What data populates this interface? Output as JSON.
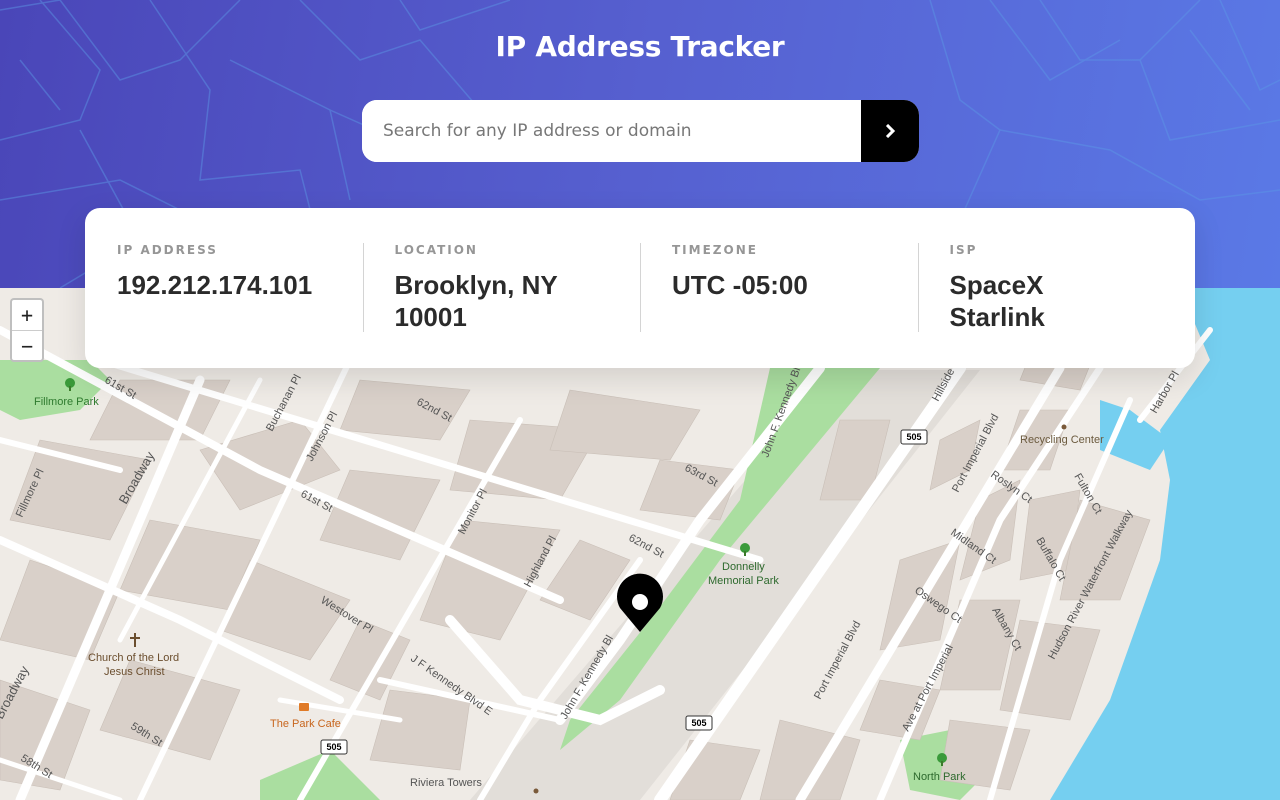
{
  "header": {
    "title": "IP Address Tracker",
    "search_placeholder": "Search for any IP address or domain",
    "search_value": ""
  },
  "info": [
    {
      "label": "IP ADDRESS",
      "value": "192.212.174.101"
    },
    {
      "label": "LOCATION",
      "value": "Brooklyn, NY 10001"
    },
    {
      "label": "TIMEZONE",
      "value": "UTC -05:00"
    },
    {
      "label": "ISP",
      "value": "SpaceX Starlink"
    }
  ],
  "map": {
    "zoom_in": "+",
    "zoom_out": "−",
    "labels": {
      "fillmore_park": "Fillmore Park",
      "st_61": "61st St",
      "buchanan": "Buchanan Pl",
      "johnson": "Johnson Pl",
      "st_62": "62nd St",
      "jfk_blvd": "John F. Kennedy Blvd",
      "hillside": "Hillside",
      "harbor": "Harbor Pl",
      "port_imperial": "Port Imperial Blvd",
      "recycling": "Recycling Center",
      "fillmore_pl": "Fillmore Pl",
      "broadway": "Broadway",
      "st_61b": "61st St",
      "monitor": "Monitor Pl",
      "st_63": "63rd St",
      "roslyn": "Roslyn Ct",
      "fulton": "Fulton Ct",
      "hudson": "Hudson River Waterfront Walkway",
      "highland": "Highland Pl",
      "st_62b": "62nd St",
      "donnelly": "Donnelly",
      "memorial": "Memorial Park",
      "midland": "Midland Ct",
      "buffalo": "Buffalo Ct",
      "westover": "Westover Pl",
      "oswego": "Oswego Ct",
      "church1": "Church of the Lord",
      "church2": "Jesus Christ",
      "albany": "Albany Ct",
      "port_imperial2": "Port Imperial Blvd",
      "jfk_e": "J F Kennedy Blvd E",
      "jfk_b2": "John F. Kennedy Bl",
      "ave_port": "Ave at Port Imperial",
      "broadway2": "Broadway",
      "park_cafe": "The Park Cafe",
      "st_59": "59th St",
      "north_park": "North Park",
      "st_58": "58th St",
      "riviera": "Riviera Towers",
      "route": "505"
    },
    "colors": {
      "water": "#75cff0",
      "park": "#aadea0",
      "building": "#d9d0c9",
      "road": "#ffffff",
      "marker": "#000000"
    }
  }
}
